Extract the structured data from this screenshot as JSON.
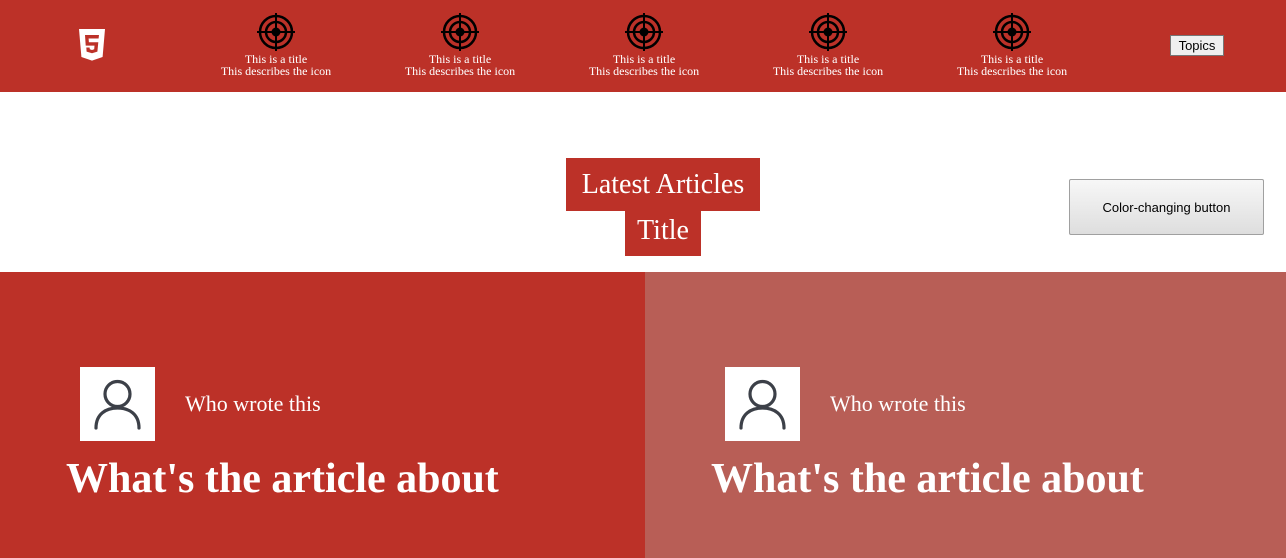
{
  "header": {
    "logo_icon": "html5-icon",
    "nav_items": [
      {
        "icon": "target-icon",
        "title": "This is a title",
        "description": "This describes the icon"
      },
      {
        "icon": "target-icon",
        "title": "This is a title",
        "description": "This describes the icon"
      },
      {
        "icon": "target-icon",
        "title": "This is a title",
        "description": "This describes the icon"
      },
      {
        "icon": "target-icon",
        "title": "This is a title",
        "description": "This describes the icon"
      },
      {
        "icon": "target-icon",
        "title": "This is a title",
        "description": "This describes the icon"
      }
    ],
    "topics_label": "Topics"
  },
  "section": {
    "heading": "Latest Articles",
    "subheading": "Title",
    "color_button_label": "Color-changing button"
  },
  "articles": [
    {
      "author": "Who wrote this",
      "title": "What's the article about",
      "avatar_icon": "user-icon"
    },
    {
      "author": "Who wrote this",
      "title": "What's the article about",
      "avatar_icon": "user-icon"
    }
  ],
  "colors": {
    "brand_red": "#bc3128",
    "faded_red": "#b85e56"
  }
}
